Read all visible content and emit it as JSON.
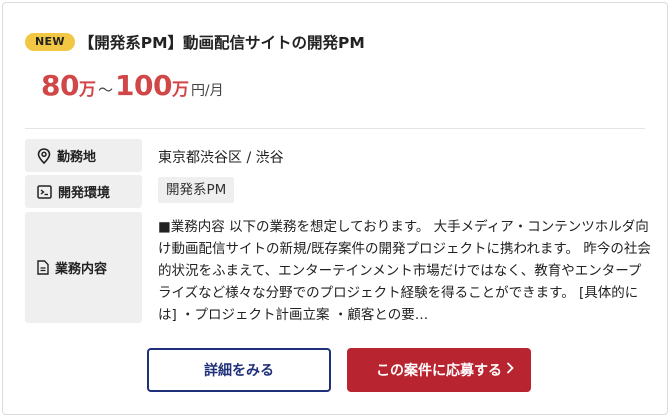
{
  "job": {
    "badge": "NEW",
    "title": "【開発系PM】動画配信サイトの開発PM",
    "salary": {
      "min": "80",
      "max": "100",
      "unit_man": "万",
      "tilde": "〜",
      "unit_period": "円/月"
    },
    "details": {
      "location_label": "勤務地",
      "location_value": "東京都渋谷区 / 渋谷",
      "env_label": "開発環境",
      "env_tag": "開発系PM",
      "work_label": "業務内容",
      "work_text": "■業務内容 以下の業務を想定しております。 大手メディア・コンテンツホルダ向け動画配信サイトの新規/既存案件の開発プロジェクトに携われます。 昨今の社会的状況をふまえて、エンターテインメント市場だけではなく、教育やエンタープライズなど様々な分野でのプロジェクト経験を得ることができます。 [具体的には] ・プロジェクト計画立案 ・顧客との要…"
    },
    "buttons": {
      "detail": "詳細をみる",
      "apply": "この案件に応募する"
    }
  },
  "colors": {
    "badge": "#f2c744",
    "salary": "#d14748",
    "detail_border": "#20307a",
    "apply_bg": "#b82430"
  },
  "icons": [
    "location-pin-icon",
    "terminal-icon",
    "document-icon",
    "chevron-right-icon"
  ]
}
